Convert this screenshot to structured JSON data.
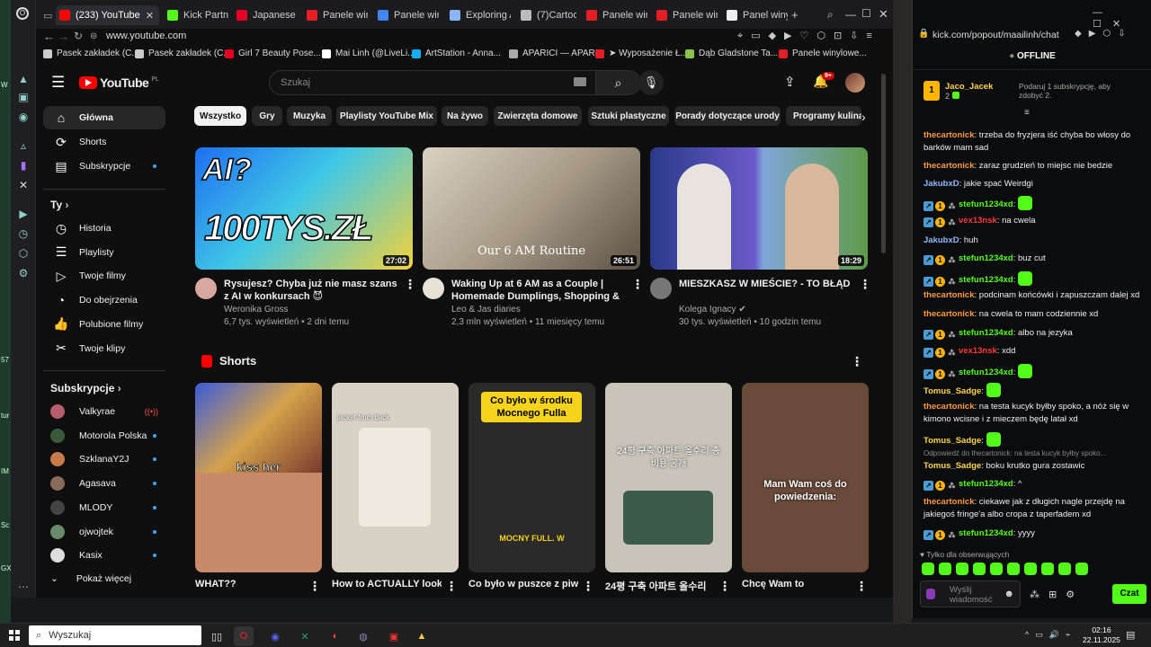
{
  "desktop": {
    "edge_texts": [
      "W",
      "57",
      "tur",
      "IM",
      "Sc",
      "GX"
    ]
  },
  "browser": {
    "tabs": [
      {
        "label": "(233) YouTube",
        "icon": "youtube-icon",
        "color": "#ff0000",
        "active": true
      },
      {
        "label": "Kick Partne",
        "icon": "kick-icon",
        "color": "#53fc18"
      },
      {
        "label": "Japanese K",
        "icon": "pinterest-icon",
        "color": "#e60023"
      },
      {
        "label": "Panele winy",
        "icon": "n-icon",
        "color": "#e31e24"
      },
      {
        "label": "Panele wini",
        "icon": "google-lens-icon",
        "color": "#4285f4"
      },
      {
        "label": "Exploring A",
        "icon": "globe-icon",
        "color": "#8ab4f8"
      },
      {
        "label": "(7)Cartoonii",
        "icon": "globe-icon",
        "color": "#bbbbbb"
      },
      {
        "label": "Panele winy",
        "icon": "n-icon",
        "color": "#e31e24"
      },
      {
        "label": "Panele wini",
        "icon": "n-icon",
        "color": "#e31e24"
      },
      {
        "label": "Panel winylo",
        "icon": "page-icon",
        "color": "#eeeeee"
      }
    ],
    "url": "www.youtube.com",
    "bookmarks": [
      {
        "label": "Pasek zakładek (C...",
        "icon": "folder-icon"
      },
      {
        "label": "Pasek zakładek (C...",
        "icon": "folder-icon"
      },
      {
        "label": "Girl 7 Beauty Pose...",
        "icon": "pinterest-icon"
      },
      {
        "label": "Mai Linh (@LiveLi...",
        "icon": "x-icon"
      },
      {
        "label": "ArtStation - Anna...",
        "icon": "artstation-icon"
      },
      {
        "label": "APARICI — APARI...",
        "icon": "page-icon"
      },
      {
        "label": "➤ Wyposażenie Ł...",
        "icon": "n-icon"
      },
      {
        "label": "Dąb Gladstone Ta...",
        "icon": "diamond-icon"
      },
      {
        "label": "Panele winylowe...",
        "icon": "n-icon"
      }
    ]
  },
  "youtube": {
    "logo_text": "YouTube",
    "region": "PL",
    "search_placeholder": "Szukaj",
    "notif_count": "9+",
    "guide": [
      {
        "label": "Główna",
        "icon": "home-icon",
        "selected": true
      },
      {
        "label": "Shorts",
        "icon": "shorts-icon"
      },
      {
        "label": "Subskrypcje",
        "icon": "subscriptions-icon",
        "dot": true
      }
    ],
    "you_header": "Ty",
    "you_items": [
      {
        "label": "Historia",
        "icon": "history-icon"
      },
      {
        "label": "Playlisty",
        "icon": "playlist-icon"
      },
      {
        "label": "Twoje filmy",
        "icon": "your-videos-icon"
      },
      {
        "label": "Do obejrzenia",
        "icon": "watch-later-icon"
      },
      {
        "label": "Polubione filmy",
        "icon": "like-icon"
      },
      {
        "label": "Twoje klipy",
        "icon": "clips-icon"
      }
    ],
    "subs_header": "Subskrypcje",
    "subs": [
      {
        "label": "Valkyrae",
        "color": "#b85e6e",
        "live": true
      },
      {
        "label": "Motorola Polska",
        "color": "#3a5a3a",
        "dot": true
      },
      {
        "label": "SzklanaY2J",
        "color": "#c97a4a",
        "dot": true
      },
      {
        "label": "Agasava",
        "color": "#8a6a5a",
        "dot": true
      },
      {
        "label": "MLODY",
        "color": "#444",
        "dot": true
      },
      {
        "label": "ojwojtek",
        "color": "#6a8a6a",
        "dot": true
      },
      {
        "label": "Kasix",
        "color": "#ddd",
        "dot": true
      }
    ],
    "show_more": "Pokaż więcej",
    "chips": [
      "Wszystko",
      "Gry",
      "Muzyka",
      "Playlisty YouTube Mix",
      "Na żywo",
      "Zwierzęta domowe",
      "Sztuki plastyczne",
      "Porady dotyczące urody",
      "Programy kulinar"
    ],
    "videos": [
      {
        "title": "Rysujesz? Chyba już nie masz szans z AI w konkursach 😈",
        "channel": "Weronika Gross",
        "meta": "6,7 tys. wyświetleń • 2 dni temu",
        "duration": "27:02",
        "thumb_text": "100TYS.ZŁ",
        "thumb_top": "AI?",
        "verified": false
      },
      {
        "title": "Waking Up at 6 AM as a Couple | Homemade Dumplings, Shopping & ...",
        "channel": "Leo & Jas diaries",
        "meta": "2,3 mln wyświetleń • 11 miesięcy temu",
        "duration": "26:51",
        "thumb_text": "Our 6 AM Routine",
        "verified": false
      },
      {
        "title": "MIESZKASZ W MIEŚCIE? - TO BŁĄD",
        "channel": "Kolega Ignacy",
        "meta": "30 tys. wyświetleń • 10 godzin temu",
        "duration": "18:29",
        "verified": true
      }
    ],
    "shorts_header": "Shorts",
    "shorts": [
      {
        "title": "WHAT??",
        "overlay": "kiss her",
        "bg": "#c98a6a"
      },
      {
        "title": "How to ACTUALLY look",
        "overlay": "jacket from back",
        "bg": "#d8d2c6"
      },
      {
        "title": "Co było w puszce z piwa",
        "overlay": "Co było w środku Mocnego Fulla",
        "overlay2": "MOCNY FULL. W",
        "bg": "#2a2a2a"
      },
      {
        "title": "24평 구축 아파트 올수리",
        "overlay": "24평 구축 아파트 올수리 총비용 공개",
        "bg": "#c9c4ba"
      },
      {
        "title": "Chcę Wam to",
        "overlay": "Mam Wam coś do powiedzenia:",
        "bg": "#6a4a3a"
      }
    ]
  },
  "chat": {
    "url": "kick.com/popout/maailinh/chat",
    "status": "OFFLINE",
    "top_user": "Jaco_Jacek",
    "top_user_count": "2",
    "gift_text": "Podaruj 1 subskrypcję, aby zdobyć 2.",
    "messages": [
      {
        "user": "thecartonick",
        "color": "#ff9b3c",
        "text": "trzeba do fryzjera iść chyba bo włosy do barków mam sad"
      },
      {
        "user": "thecartonick",
        "color": "#ff9b3c",
        "text": "zaraz grudzień to miejsc nie bedzie"
      },
      {
        "user": "JakubxD",
        "color": "#8fb8ff",
        "text": "jakie spać Weirdgi"
      },
      {
        "user": "stefun1234xd",
        "color": "#53fc18",
        "text": "",
        "badges": true,
        "emote": true
      },
      {
        "user": "vex13nsk",
        "color": "#ff3b3b",
        "text": "na cwela",
        "badges": true
      },
      {
        "user": "JakubxD",
        "color": "#8fb8ff",
        "text": "huh"
      },
      {
        "user": "stefun1234xd",
        "color": "#53fc18",
        "text": "buz cut",
        "badges": true
      },
      {
        "user": "stefun1234xd",
        "color": "#53fc18",
        "text": "",
        "badges": true,
        "emote": true
      },
      {
        "user": "thecartonick",
        "color": "#ff9b3c",
        "text": "podcinam końcówki i zapuszczam dalej xd"
      },
      {
        "user": "thecartonick",
        "color": "#ff9b3c",
        "text": "na cwela to mam codziennie xd"
      },
      {
        "user": "stefun1234xd",
        "color": "#53fc18",
        "text": "albo na jezyka",
        "badges": true
      },
      {
        "user": "vex13nsk",
        "color": "#ff3b3b",
        "text": "xdd",
        "badges": true
      },
      {
        "user": "stefun1234xd",
        "color": "#53fc18",
        "text": "",
        "badges": true,
        "emote": true
      },
      {
        "user": "Tomus_Sadge",
        "color": "#ffd54a",
        "text": "",
        "emote": true
      },
      {
        "user": "thecartonick",
        "color": "#ff9b3c",
        "text": "na testa kucyk byłby spoko, a nóż się w kimono wcisne i z mieczem będę latał xd"
      },
      {
        "user": "Tomus_Sadge",
        "color": "#ffd54a",
        "text": "",
        "emote": true
      },
      {
        "user": "Tomus_Sadge",
        "color": "#ffd54a",
        "text": "boku krutko gura zostawic",
        "reply": "Odpowiedź do thecartonick: na testa kucyk byłby spoko..."
      },
      {
        "user": "stefun1234xd",
        "color": "#53fc18",
        "text": "^",
        "badges": true
      },
      {
        "user": "thecartonick",
        "color": "#ff9b3c",
        "text": "ciekawe jak z długich nagle przejdę na jakiegoś fringe'a albo cropa z taperfadem xd"
      },
      {
        "user": "stefun1234xd",
        "color": "#53fc18",
        "text": "yyyy",
        "badges": true
      }
    ],
    "followers_only": "Tylko dla obserwujących",
    "input_placeholder": "Wyślij wiadomość",
    "send_label": "Czat"
  },
  "taskbar": {
    "search_placeholder": "Wyszukaj",
    "time": "02:16",
    "date": "22.11.2025"
  }
}
